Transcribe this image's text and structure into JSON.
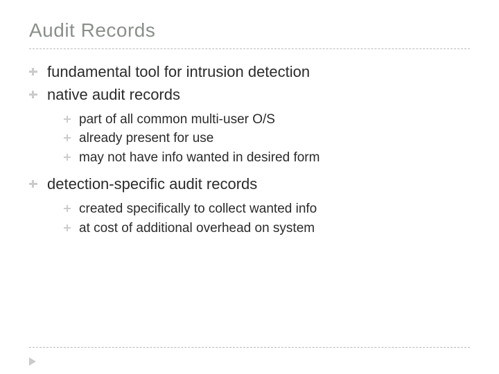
{
  "title": "Audit Records",
  "bullets": {
    "b1": "fundamental tool for intrusion detection",
    "b2": "native audit records",
    "b2_sub": {
      "s1": "part of all common multi-user O/S",
      "s2": "already present for use",
      "s3": "may not have info wanted in desired form"
    },
    "b3": "detection-specific audit records",
    "b3_sub": {
      "s1": "created specifically to collect wanted info",
      "s2": "at cost of additional overhead on system"
    }
  }
}
